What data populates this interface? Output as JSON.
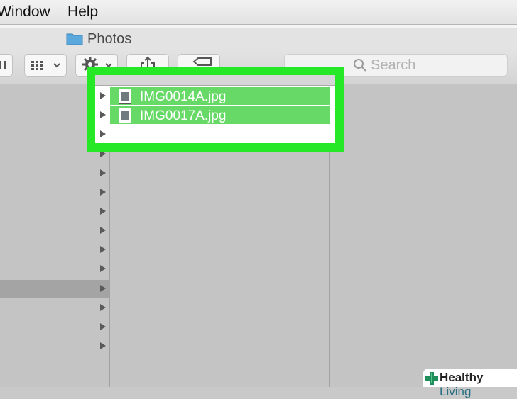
{
  "menubar": {
    "items": [
      "Window",
      "Help"
    ]
  },
  "window": {
    "title": "Photos"
  },
  "toolbar": {
    "search_placeholder": "Search",
    "buttons": [
      "view-options",
      "action",
      "share",
      "tags"
    ]
  },
  "files": [
    {
      "name": "IMG0014A.jpg",
      "selected": true
    },
    {
      "name": "IMG0017A.jpg",
      "selected": true
    }
  ],
  "brand": {
    "part1": "Healthy",
    "part2": " Living"
  },
  "colors": {
    "highlight": "#26e826",
    "selection": "#66d966"
  }
}
